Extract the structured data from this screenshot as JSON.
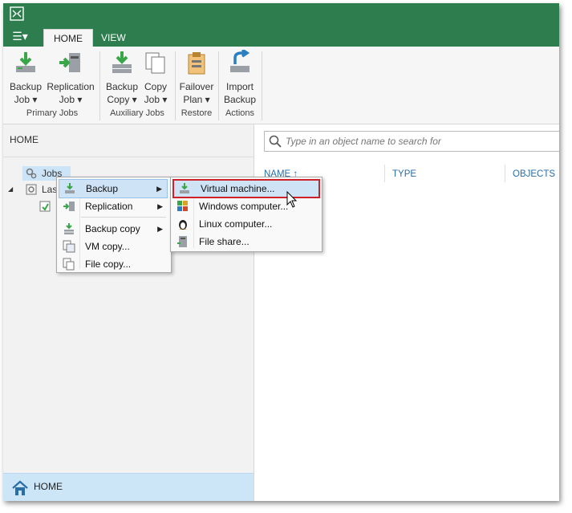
{
  "tabs": [
    "HOME",
    "VIEW"
  ],
  "ribbon": {
    "groups": [
      {
        "label": "Primary Jobs",
        "buttons": [
          {
            "line1": "Backup",
            "line2": "Job ▾"
          },
          {
            "line1": "Replication",
            "line2": "Job ▾"
          }
        ]
      },
      {
        "label": "Auxiliary Jobs",
        "buttons": [
          {
            "line1": "Backup",
            "line2": "Copy ▾"
          },
          {
            "line1": "Copy",
            "line2": "Job ▾"
          }
        ]
      },
      {
        "label": "Restore",
        "buttons": [
          {
            "line1": "Failover",
            "line2": "Plan ▾"
          }
        ]
      },
      {
        "label": "Actions",
        "buttons": [
          {
            "line1": "Import",
            "line2": "Backup"
          }
        ]
      }
    ]
  },
  "left_pane": {
    "header": "HOME",
    "tree": [
      {
        "label": "Jobs"
      },
      {
        "label": "Las"
      }
    ],
    "bottom_nav": "HOME"
  },
  "search": {
    "placeholder": "Type in an object name to search for"
  },
  "columns": [
    "NAME ↑",
    "TYPE",
    "OBJECTS"
  ],
  "context_menu": {
    "items": [
      "Backup",
      "Replication",
      "Backup copy",
      "VM copy...",
      "File copy..."
    ]
  },
  "submenu": {
    "items": [
      "Virtual machine...",
      "Windows computer...",
      "Linux computer...",
      "File share..."
    ]
  },
  "colors": {
    "brand": "#2e7d4f",
    "highlight": "#cfe3f7",
    "selection_border": "#d0202a",
    "icon_green": "#3aa64a"
  }
}
